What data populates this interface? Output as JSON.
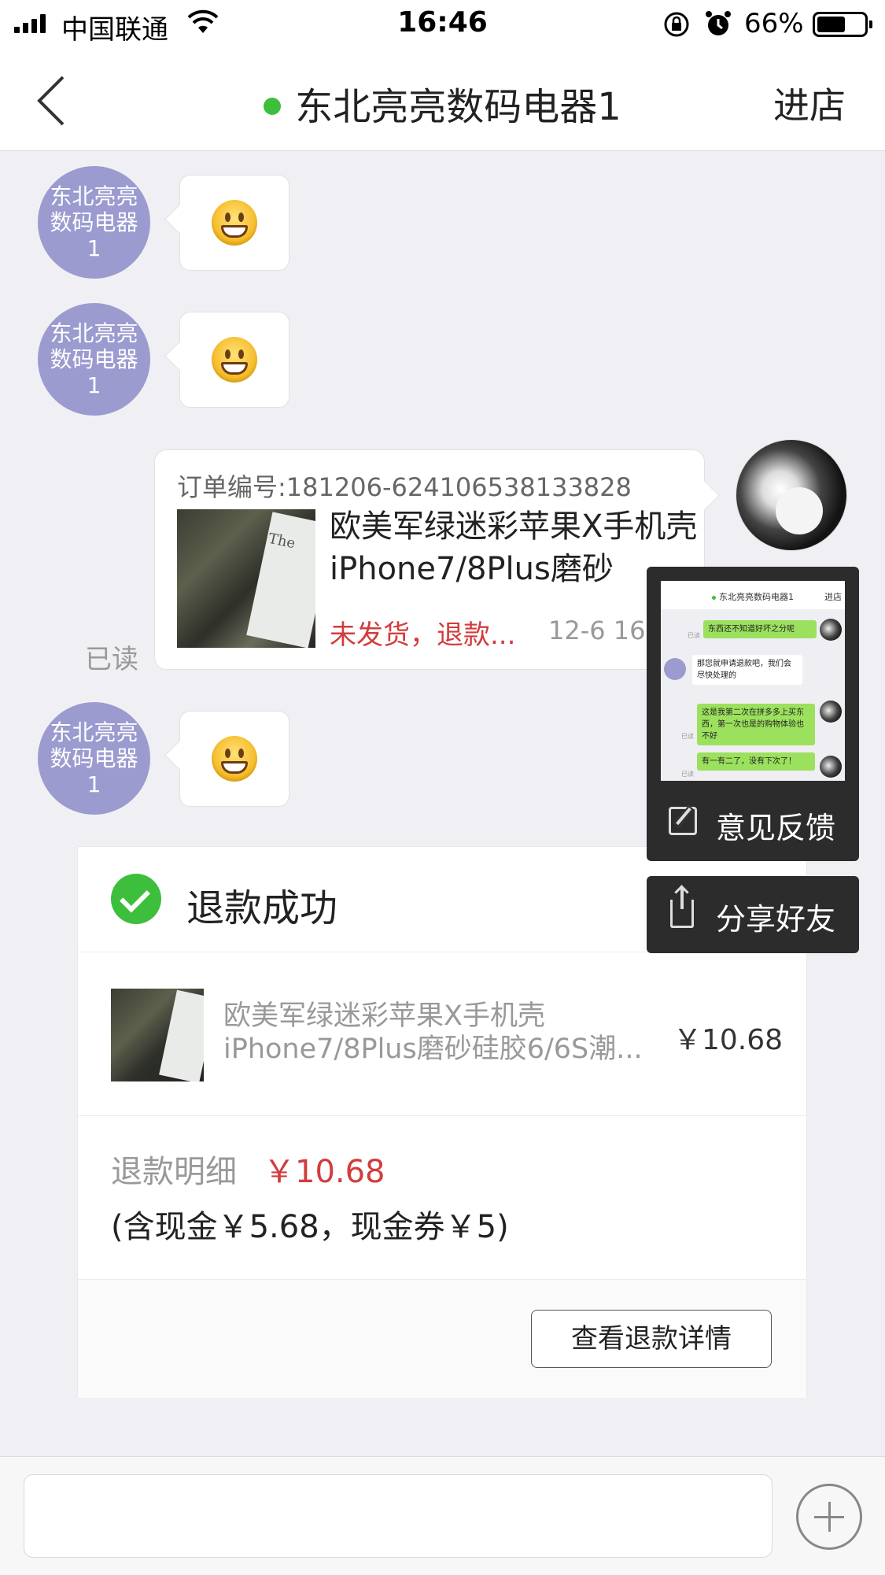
{
  "status_bar": {
    "carrier": "中国联通",
    "time": "16:46",
    "battery": "66%"
  },
  "nav": {
    "title": "东北亮亮数码电器1",
    "enter_store": "进店"
  },
  "messages": {
    "shop_name_avatar": "东北亮亮数码电器1",
    "order": {
      "order_no": "订单编号:181206-624106538133828",
      "product_name": "欧美军绿迷彩苹果X手机壳iPhone7/8Plus磨砂",
      "status": "未发货，退款...",
      "time": "12-6 16:0",
      "thumb_text": "The"
    },
    "read_label": "已读"
  },
  "refund": {
    "title": "退款成功",
    "product_line1": "欧美军绿迷彩苹果X手机壳",
    "product_line2": "iPhone7/8Plus磨砂硅胶6/6S潮...",
    "price": "￥10.68",
    "detail_label": "退款明细",
    "detail_amount": "￥10.68",
    "breakdown": "(含现金￥5.68，现金券￥5)",
    "view_detail": "查看退款详情"
  },
  "screenshot_panel": {
    "preview_title": "东北亮亮数码电器1",
    "preview_store": "进店",
    "preview_msgs": [
      "东西还不知道好坏之分呢",
      "那您就申请退款吧，我们会尽快处理的",
      "这是我第二次在拼多多上买东西，第一次也是的购物体验也不好",
      "有一有二了，没有下次了！"
    ],
    "preview_read": "已读",
    "feedback": "意见反馈",
    "share": "分享好友"
  },
  "input": {
    "placeholder": ""
  }
}
